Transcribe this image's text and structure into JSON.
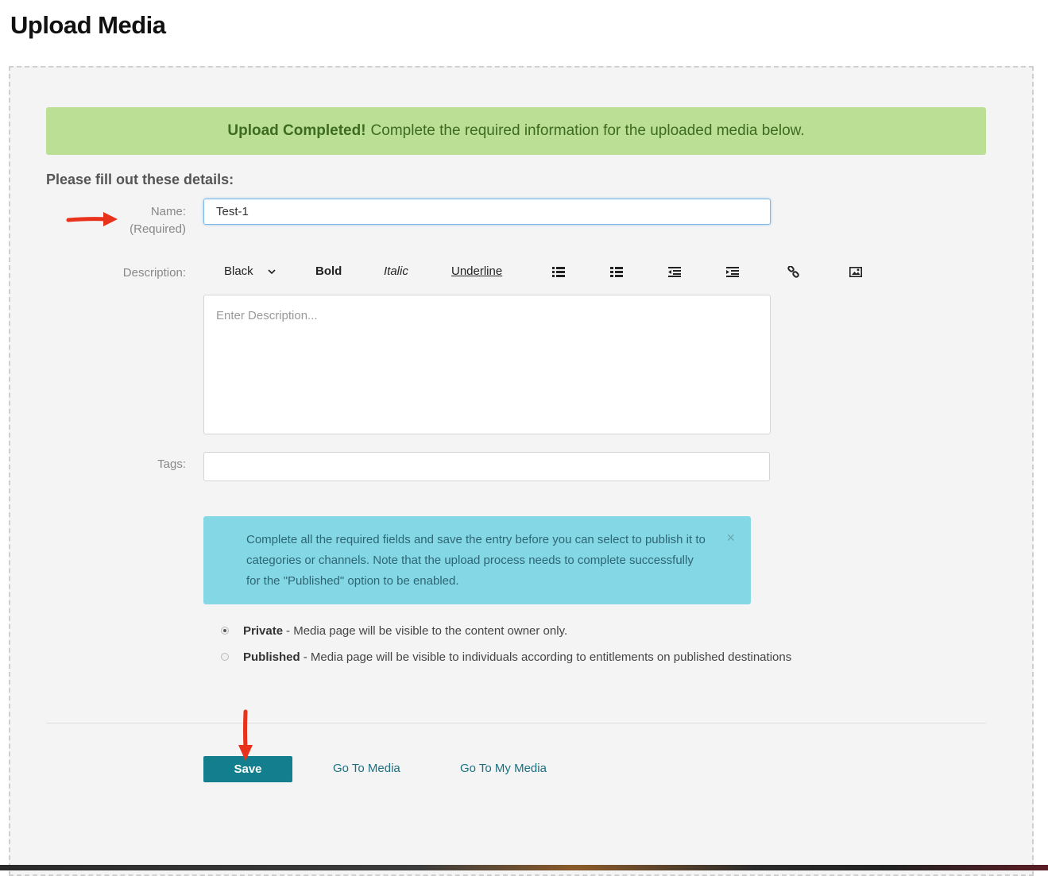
{
  "page": {
    "title": "Upload Media"
  },
  "banner": {
    "strong_text": "Upload Completed!",
    "text": "Complete the required information for the uploaded media below."
  },
  "form": {
    "heading": "Please fill out these details:",
    "name": {
      "label": "Name:",
      "sublabel": "(Required)",
      "value": "Test-1"
    },
    "description": {
      "label": "Description:",
      "placeholder": "Enter Description...",
      "toolbar": {
        "color": "Black",
        "bold": "Bold",
        "italic": "Italic",
        "underline": "Underline",
        "icons": [
          "bulleted-list-icon",
          "numbered-list-icon",
          "outdent-icon",
          "indent-icon",
          "link-icon",
          "image-icon"
        ]
      }
    },
    "tags": {
      "label": "Tags:",
      "value": ""
    }
  },
  "info": {
    "text": "Complete all the required fields and save the entry before you can select to publish it to categories or channels. Note that the upload process needs to complete successfully for the \"Published\" option to be enabled.",
    "close": "×"
  },
  "publish_options": [
    {
      "title": "Private",
      "description": "- Media page will be visible to the content owner only.",
      "selected": true
    },
    {
      "title": "Published",
      "description": "- Media page will be visible to individuals according to entitlements on published destinations",
      "selected": false
    }
  ],
  "actions": {
    "save": "Save",
    "go_to_media": "Go To Media",
    "go_to_my_media": "Go To My Media"
  },
  "colors": {
    "success_banner": "#bcdf96",
    "info_box": "#84d8e6",
    "primary_button": "#137f8e",
    "link": "#1b6f82",
    "annotation_arrow": "#e8321c"
  }
}
